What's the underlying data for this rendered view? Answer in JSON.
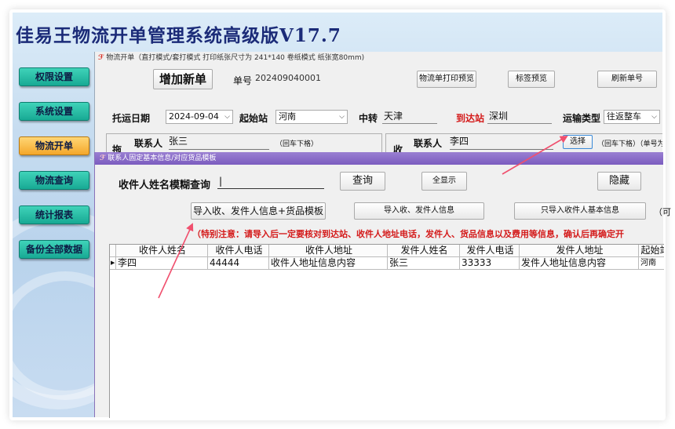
{
  "app": {
    "title": "佳易王物流开单管理系统高级版V17.7"
  },
  "sidebar": {
    "items": [
      {
        "label": "权限设置"
      },
      {
        "label": "系统设置"
      },
      {
        "label": "物流开单",
        "active": true
      },
      {
        "label": "物流查询"
      },
      {
        "label": "统计报表"
      },
      {
        "label": "备份全部数据"
      }
    ]
  },
  "main": {
    "window_title": "物流开单（直打模式/套打模式 打印纸张尺寸为 241*140 卷纸模式 纸张宽80mm)",
    "add_new_label": "增加新单",
    "order_no_label": "单号",
    "order_no_value": "202409040001",
    "print_preview_label": "物流单打印预览",
    "label_preview_label": "标签预览",
    "refresh_no_label": "刷新单号",
    "ship_date_label": "托运日期",
    "ship_date_value": "2024-09-04",
    "origin_label": "起始站",
    "origin_value": "河南",
    "transit_label": "中转",
    "transit_value": "天津",
    "dest_label": "到达站",
    "dest_value": "深圳",
    "transport_type_label": "运输类型",
    "transport_type_value": "往返整车",
    "sender_side_label": "拖",
    "sender_contact_label": "联系人",
    "sender_contact_value": "张三",
    "sender_note": "（回车下格）",
    "receiver_side_label": "收",
    "receiver_contact_label": "联系人",
    "receiver_contact_value": "李四",
    "select_button_label": "选择",
    "receiver_note": "（回车下格）（单号为"
  },
  "dialog": {
    "title": "联系人固定基本信息/对应货品模板",
    "search_label": "收件人姓名模糊查询",
    "search_value": "",
    "query_label": "查询",
    "show_all_label": "全显示",
    "hide_label": "隐藏",
    "import_all_label": "导入收、发件人信息+货品模板",
    "import_contacts_label": "导入收、发件人信息",
    "import_receiver_label": "只导入收件人基本信息",
    "trailing_text": "（可",
    "warning": "（特别注意：请导入后一定要核对到达站、收件人地址电话，发件人、货品信息以及费用等信息，确认后再确定开",
    "table": {
      "columns": [
        "收件人姓名",
        "收件人电话",
        "收件人地址",
        "发件人姓名",
        "发件人电话",
        "发件人地址",
        "起始站"
      ],
      "rows": [
        [
          "李四",
          "44444",
          "收件人地址信息内容",
          "张三",
          "33333",
          "发件人地址信息内容",
          "河南"
        ]
      ]
    }
  },
  "colors": {
    "title_text": "#1b2b78",
    "sidebar_button": "#18a994",
    "sidebar_active": "#f4a72a",
    "dialog_titlebar": "#7b5cbf",
    "warning_red": "#d41a1a",
    "annotation_arrow": "#f0506e"
  }
}
